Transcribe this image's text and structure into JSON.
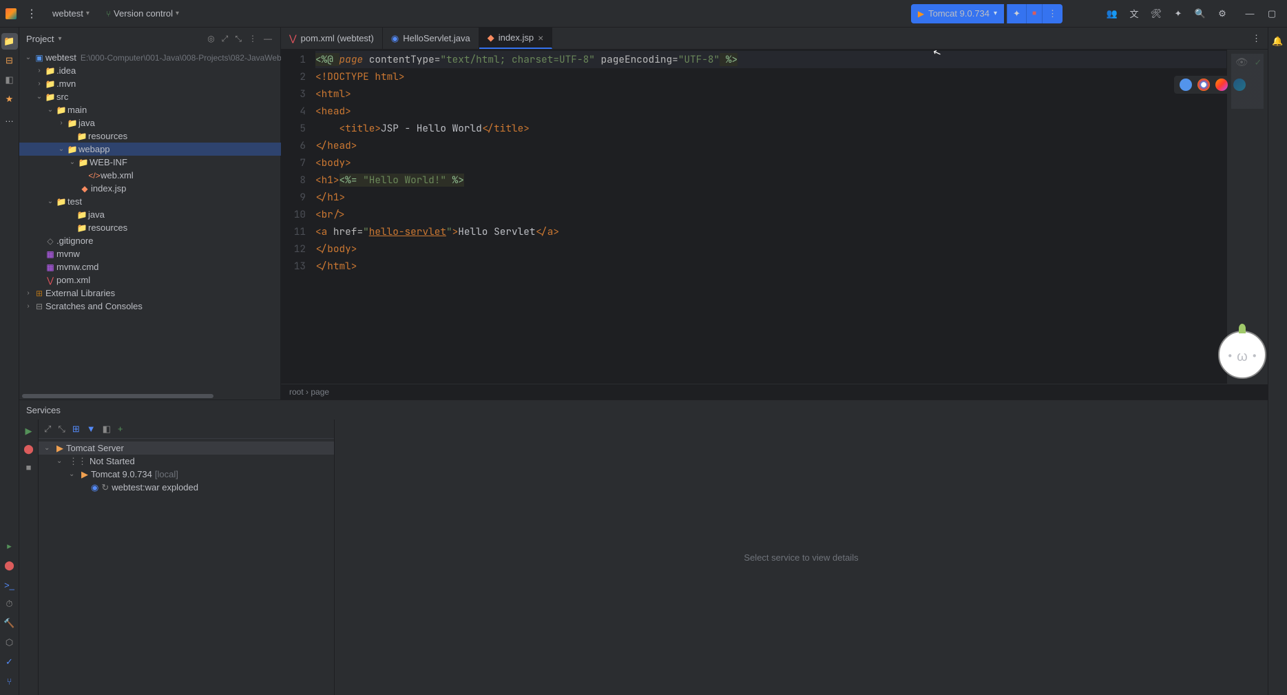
{
  "titlebar": {
    "project_name": "webtest",
    "vcs_label": "Version control",
    "run_config_label": "Tomcat 9.0.734"
  },
  "project_panel": {
    "title": "Project",
    "root": {
      "name": "webtest",
      "path": "E:\\000-Computer\\001-Java\\008-Projects\\082-JavaWeb"
    },
    "nodes": {
      "idea": ".idea",
      "mvn": ".mvn",
      "src": "src",
      "main": "main",
      "java": "java",
      "resources": "resources",
      "webapp": "webapp",
      "webinf": "WEB-INF",
      "webxml": "web.xml",
      "indexjsp": "index.jsp",
      "test": "test",
      "testjava": "java",
      "testresources": "resources",
      "gitignore": ".gitignore",
      "mvnw": "mvnw",
      "mvnwcmd": "mvnw.cmd",
      "pomxml": "pom.xml",
      "external": "External Libraries",
      "scratches": "Scratches and Consoles"
    }
  },
  "tabs": {
    "pom": "pom.xml (webtest)",
    "servlet": "HelloServlet.java",
    "jsp": "index.jsp"
  },
  "editor": {
    "breadcrumb": "root › page",
    "lines": [
      "1",
      "2",
      "3",
      "4",
      "5",
      "6",
      "7",
      "8",
      "9",
      "10",
      "11",
      "12",
      "13"
    ],
    "code": {
      "l1": {
        "a": "<%@ ",
        "b": "page",
        "c": " contentType=",
        "d": "\"text/html; charset=UTF-8\"",
        "e": " pageEncoding=",
        "f": "\"UTF-8\"",
        "g": " %>"
      },
      "l2": "<!DOCTYPE html>",
      "l3": "<html>",
      "l4": "<head>",
      "l5": {
        "a": "    <title>",
        "b": "JSP - Hello World",
        "c": "</title>"
      },
      "l6": "</head>",
      "l7": "<body>",
      "l8": {
        "a": "<h1>",
        "b": "<%= ",
        "c": "\"Hello World!\"",
        "d": " %>"
      },
      "l9": "</h1>",
      "l10": "<br/>",
      "l11": {
        "a": "<a ",
        "b": "href=",
        "c": "\"",
        "d": "hello-servlet",
        "e": "\"",
        "f": ">",
        "g": "Hello Servlet",
        "h": "</a>"
      },
      "l12": "</body>",
      "l13": "</html>"
    }
  },
  "services": {
    "title": "Services",
    "detail_placeholder": "Select service to view details",
    "tree": {
      "tomcat_server": "Tomcat Server",
      "not_started": "Not Started",
      "tomcat_instance": "Tomcat 9.0.734",
      "tomcat_hint": "[local]",
      "artifact": "webtest:war exploded"
    }
  }
}
